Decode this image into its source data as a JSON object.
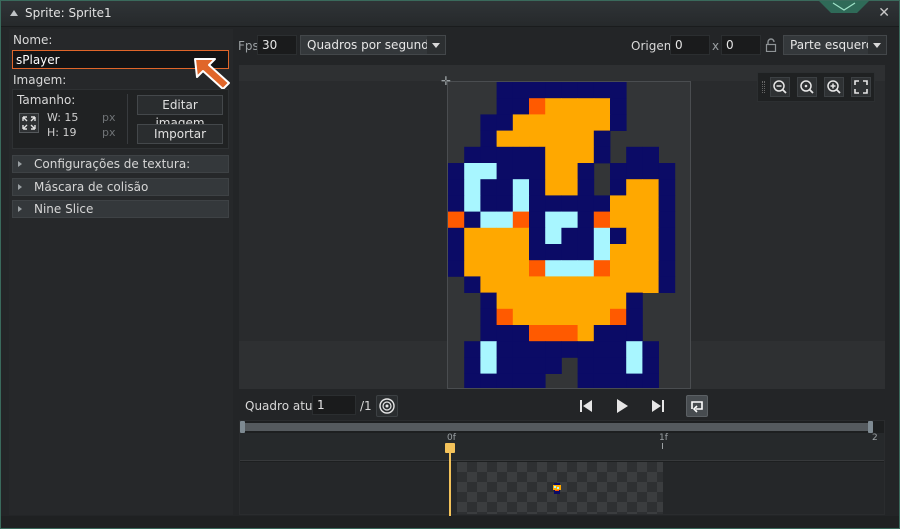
{
  "window": {
    "title": "Sprite: Sprite1"
  },
  "left": {
    "name_label": "Nome:",
    "name_value": "sPlayer",
    "image_label": "Imagem:",
    "size_label": "Tamanho:",
    "width_label": "W: 15",
    "height_label": "H: 19",
    "unit": "px",
    "edit_image": "Editar imagem",
    "import": "Importar",
    "sections": [
      "Configurações de textura:",
      "Máscara de colisão",
      "Nine Slice"
    ]
  },
  "toolbar": {
    "fps_label": "Fps",
    "fps_value": "30",
    "speed_mode": "Quadros por segundo",
    "origin_label": "Origem",
    "origin_x": "0",
    "x_label": "x",
    "origin_y": "0",
    "origin_preset": "Parte esquerda s"
  },
  "frame_controls": {
    "current_label": "Quadro atual:",
    "current_value": "1",
    "total": "/1"
  },
  "timeline": {
    "ticks": [
      "0f",
      "1f",
      "2"
    ]
  },
  "colors": {
    "accent": "#e0662a",
    "sprite_navy": "#0b0b66",
    "sprite_orange": "#ffa800",
    "sprite_red": "#ff5a00",
    "sprite_cyan": "#a8f6ff",
    "playhead": "#f3c25a"
  }
}
